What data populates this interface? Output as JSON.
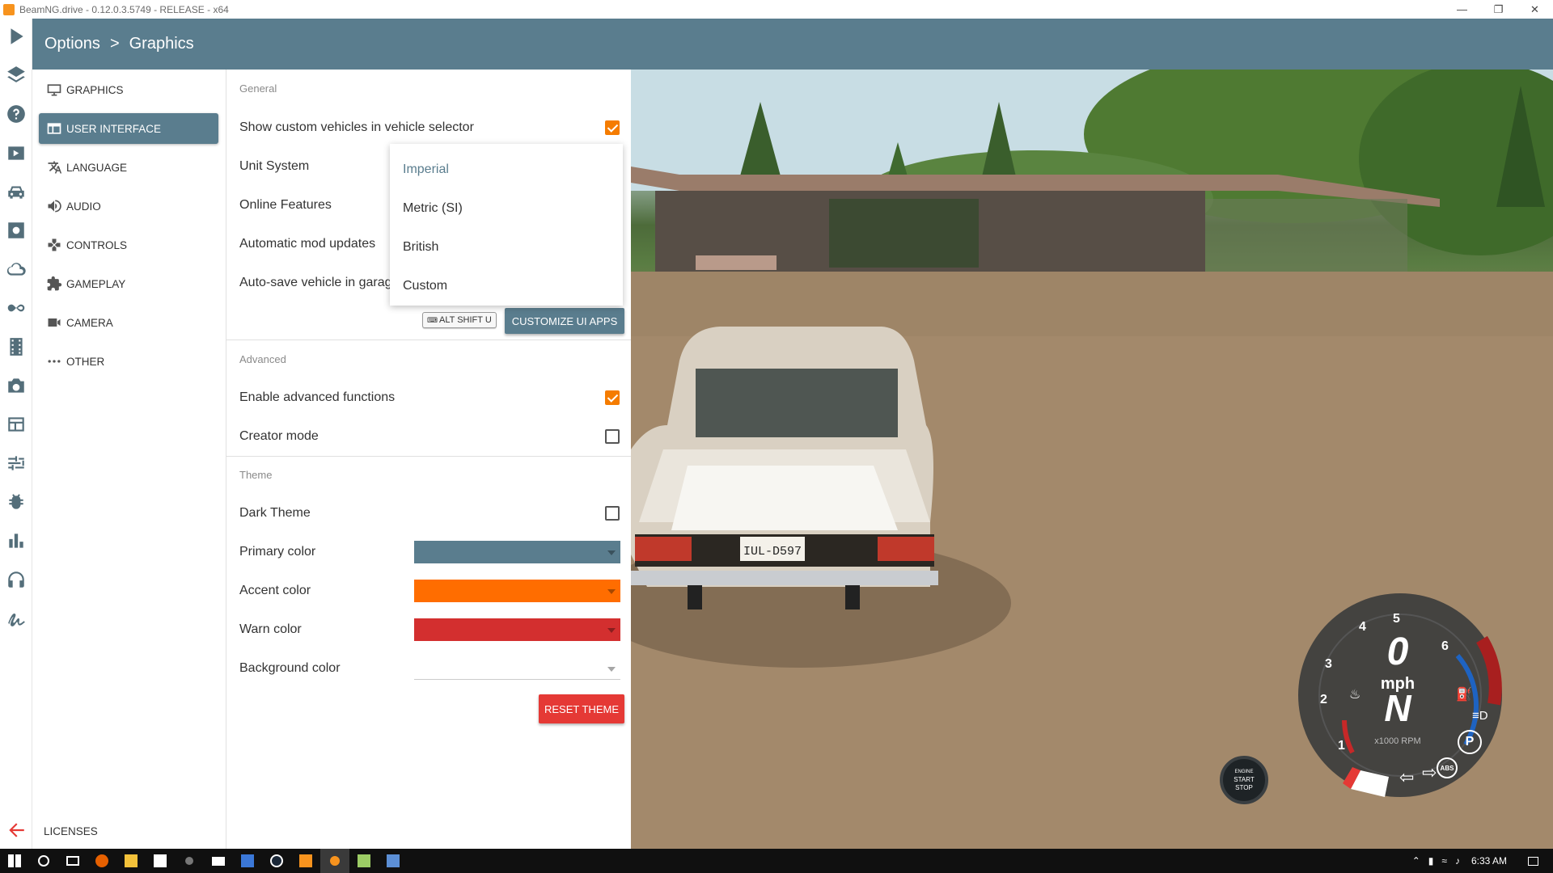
{
  "window": {
    "title": "BeamNG.drive - 0.12.0.3.5749 - RELEASE - x64"
  },
  "header": {
    "crumb_root": "Options",
    "crumb_sep": ">",
    "crumb_current": "Graphics"
  },
  "sidebar": {
    "icons": [
      "play-icon",
      "layers-icon",
      "help-icon",
      "video-play-icon",
      "car-icon",
      "settings-gear-icon",
      "cloud-icon",
      "infinity-icon",
      "film-icon",
      "camera-icon",
      "layout-icon",
      "sliders-icon",
      "bug-icon",
      "bar-chart-icon",
      "headphones-icon",
      "signature-icon",
      "back-arrow-icon"
    ]
  },
  "categories": [
    {
      "label": "GRAPHICS",
      "icon": "monitor-icon"
    },
    {
      "label": "USER INTERFACE",
      "icon": "ui-window-icon",
      "active": true
    },
    {
      "label": "LANGUAGE",
      "icon": "translate-icon"
    },
    {
      "label": "AUDIO",
      "icon": "volume-icon"
    },
    {
      "label": "CONTROLS",
      "icon": "gamepad-icon"
    },
    {
      "label": "GAMEPLAY",
      "icon": "puzzle-icon"
    },
    {
      "label": "CAMERA",
      "icon": "video-camera-icon"
    },
    {
      "label": "OTHER",
      "icon": "more-dots-icon"
    }
  ],
  "licenses": "LICENSES",
  "settings": {
    "general_title": "General",
    "show_custom_vehicles": {
      "label": "Show custom vehicles in vehicle selector",
      "checked": true
    },
    "unit_system": {
      "label": "Unit System"
    },
    "online_features": {
      "label": "Online Features"
    },
    "auto_mod_updates": {
      "label": "Automatic mod updates"
    },
    "auto_save_vehicle": {
      "label": "Auto-save vehicle in garag"
    },
    "unit_options": [
      "Imperial",
      "Metric (SI)",
      "British",
      "Custom"
    ],
    "unit_selected": "Imperial",
    "shortcut": "ALT SHIFT U",
    "customize_button": "CUSTOMIZE UI APPS",
    "advanced_title": "Advanced",
    "enable_advanced": {
      "label": "Enable advanced functions",
      "checked": true
    },
    "creator_mode": {
      "label": "Creator mode",
      "checked": false
    },
    "theme_title": "Theme",
    "dark_theme": {
      "label": "Dark Theme",
      "checked": false
    },
    "primary_color": {
      "label": "Primary color",
      "value": "#5a7d8e"
    },
    "accent_color": {
      "label": "Accent color",
      "value": "#ff6d00"
    },
    "warn_color": {
      "label": "Warn color",
      "value": "#d32f2f"
    },
    "background_color": {
      "label": "Background color"
    },
    "reset_button": "RESET THEME"
  },
  "hud": {
    "speed": "0",
    "unit": "mph",
    "gear": "N",
    "rpm_label": "x1000 RPM",
    "ticks": [
      "1",
      "2",
      "3",
      "4",
      "5",
      "6"
    ],
    "engine_button": [
      "ENGINE",
      "START",
      "STOP"
    ],
    "parking": "P",
    "abs": "ABS"
  },
  "plate": "IUL-D597",
  "taskbar": {
    "time": "6:33 AM"
  },
  "colors": {
    "primary": "#5a7d8e",
    "accent": "#f57c00",
    "warn": "#e53935"
  }
}
